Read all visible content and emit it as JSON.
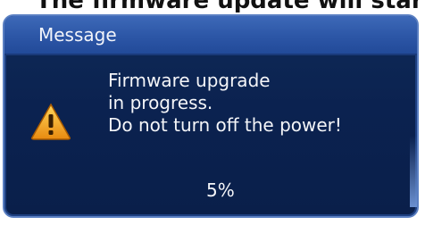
{
  "caption": {
    "text": "The firmware update will start au"
  },
  "dialog": {
    "title": "Message",
    "icon": "warning-icon",
    "message_lines": [
      "Firmware upgrade",
      "in progress.",
      "Do not turn off the power!"
    ],
    "progress_text": "5%",
    "progress_value": 0.05
  },
  "colors": {
    "dialog_background": "#0b2250",
    "titlebar": "#2c56a6",
    "border": "#5a7fc2",
    "text": "#f4f5f8",
    "warning_fill": "#f0a81e"
  }
}
